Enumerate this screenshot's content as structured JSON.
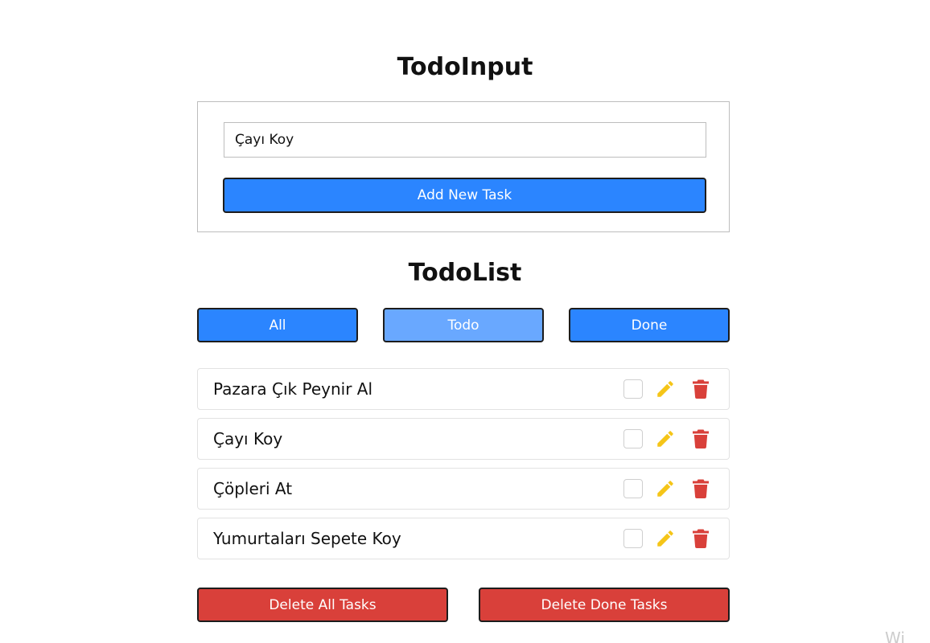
{
  "input_section": {
    "title": "TodoInput",
    "task_input_value": "Çayı Koy",
    "add_button_label": "Add New Task"
  },
  "list_section": {
    "title": "TodoList",
    "filters": [
      {
        "label": "All",
        "active": false
      },
      {
        "label": "Todo",
        "active": true
      },
      {
        "label": "Done",
        "active": false
      }
    ],
    "tasks": [
      {
        "text": "Pazara Çık Peynir Al",
        "done": false
      },
      {
        "text": "Çayı Koy",
        "done": false
      },
      {
        "text": "Çöpleri At",
        "done": false
      },
      {
        "text": "Yumurtaları Sepete Koy",
        "done": false
      }
    ]
  },
  "footer_buttons": {
    "delete_all_label": "Delete All Tasks",
    "delete_done_label": "Delete Done Tasks"
  },
  "icons": {
    "edit": "pencil-icon",
    "delete": "trash-icon"
  },
  "colors": {
    "primary": "#2b85ff",
    "primary_active": "#69a8ff",
    "danger": "#d9403a",
    "edit_icon": "#f5c518",
    "delete_icon": "#d9403a"
  },
  "watermark_text": "Wi"
}
